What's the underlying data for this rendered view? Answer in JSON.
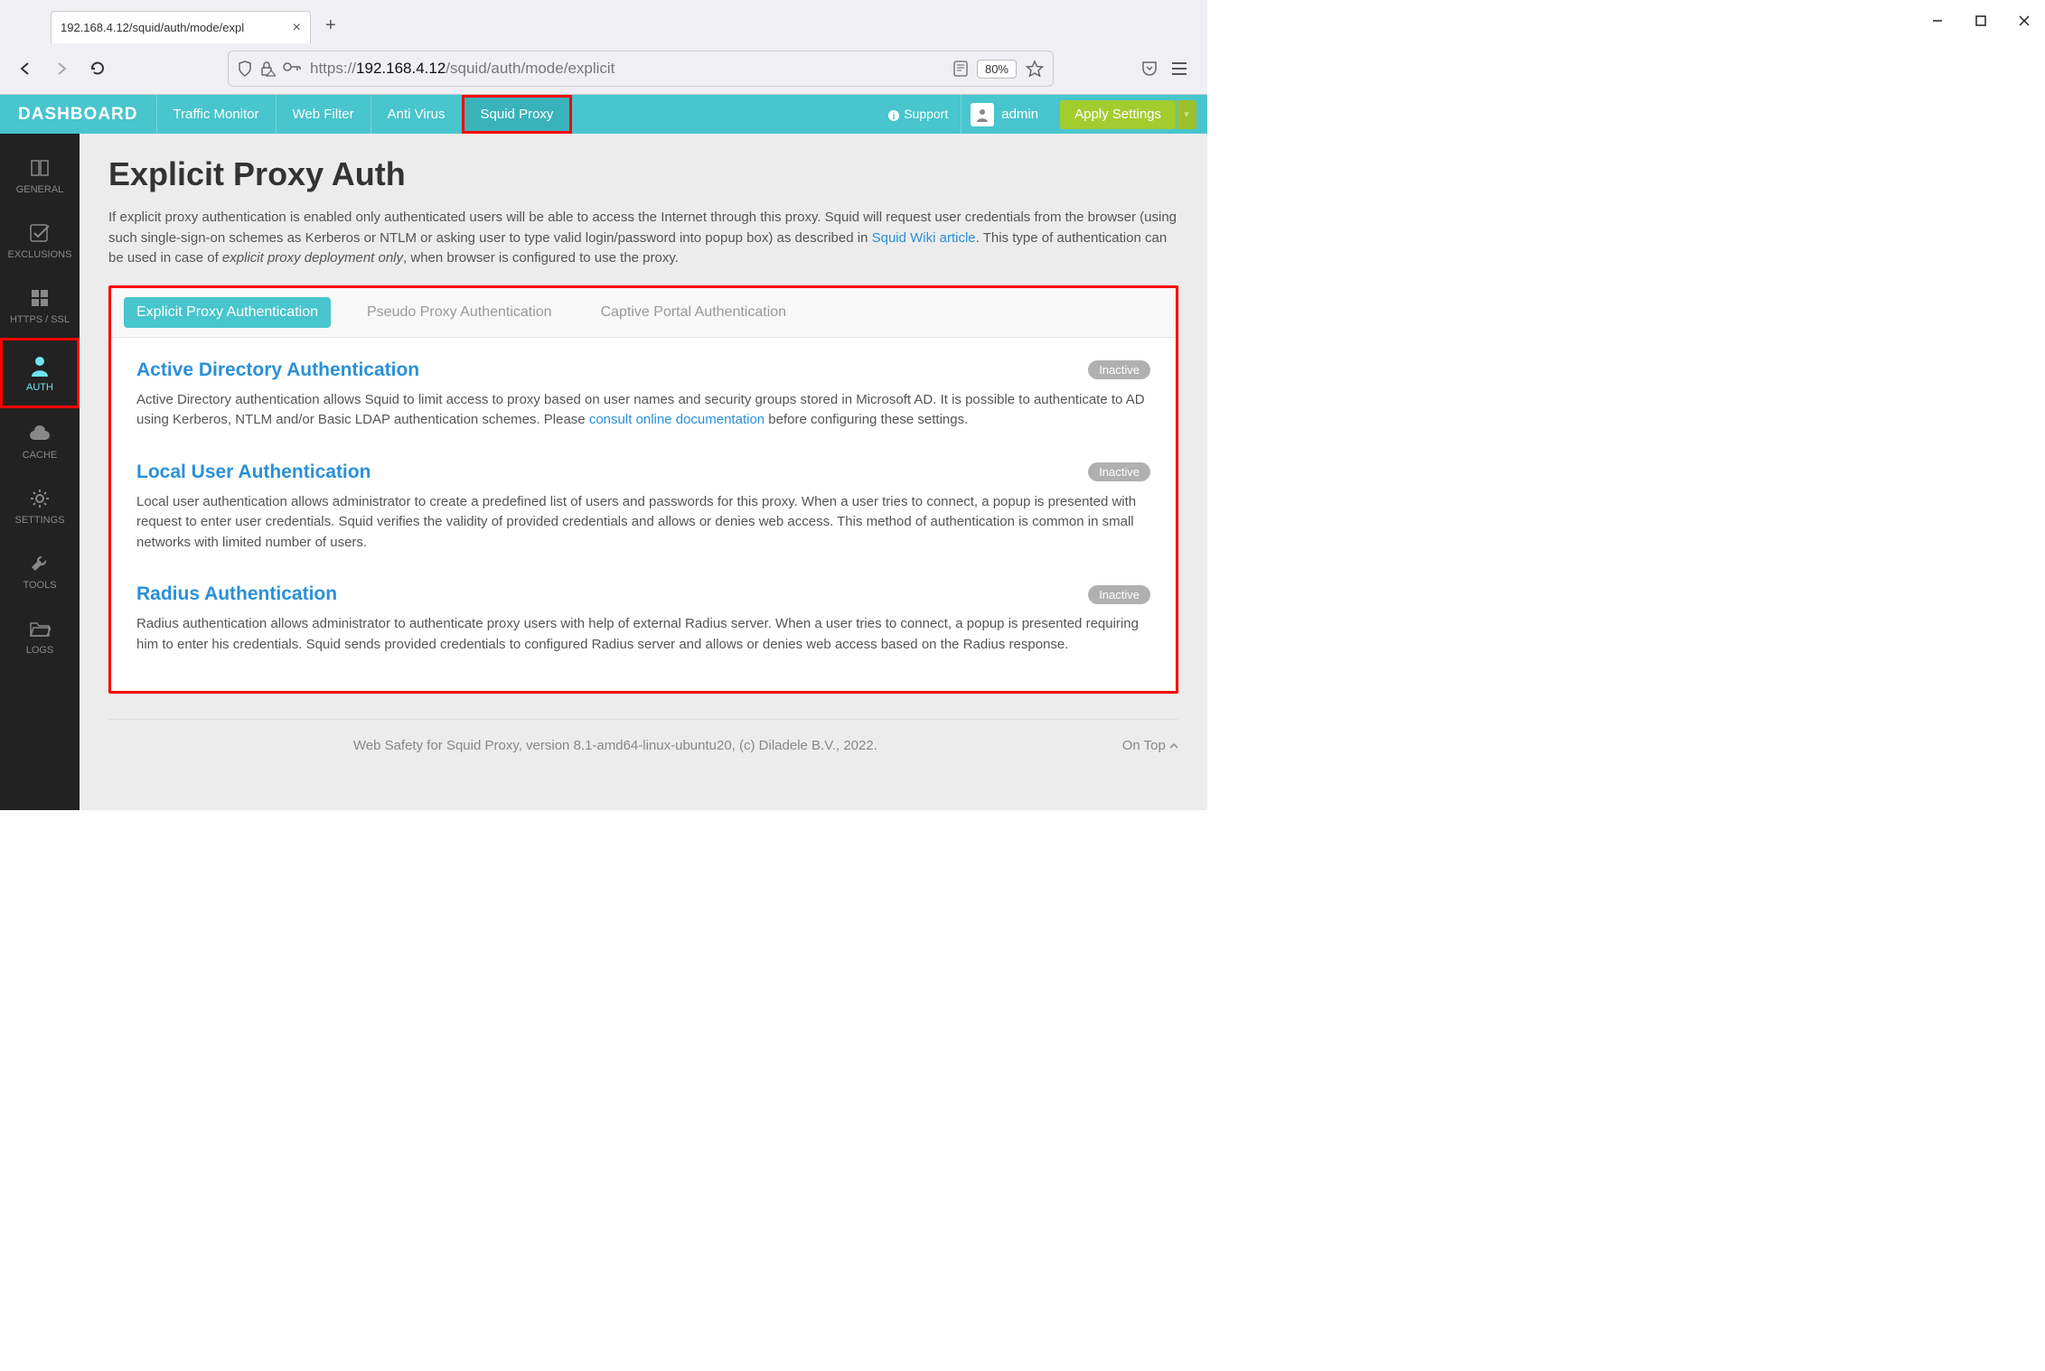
{
  "browser": {
    "tab_title": "192.168.4.12/squid/auth/mode/expl",
    "url_scheme": "https://",
    "url_host": "192.168.4.12",
    "url_path": "/squid/auth/mode/explicit",
    "zoom": "80%"
  },
  "header": {
    "brand": "DASHBOARD",
    "tabs": [
      "Traffic Monitor",
      "Web Filter",
      "Anti Virus",
      "Squid Proxy"
    ],
    "support": "Support",
    "user": "admin",
    "apply": "Apply Settings"
  },
  "sidebar": {
    "items": [
      {
        "label": "GENERAL",
        "icon": "book"
      },
      {
        "label": "EXCLUSIONS",
        "icon": "check"
      },
      {
        "label": "HTTPS / SSL",
        "icon": "grid"
      },
      {
        "label": "AUTH",
        "icon": "user"
      },
      {
        "label": "CACHE",
        "icon": "cloud"
      },
      {
        "label": "SETTINGS",
        "icon": "gear"
      },
      {
        "label": "TOOLS",
        "icon": "wrench"
      },
      {
        "label": "LOGS",
        "icon": "folder"
      }
    ]
  },
  "page": {
    "title": "Explicit Proxy Auth",
    "desc_before": "If explicit proxy authentication is enabled only authenticated users will be able to access the Internet through this proxy. Squid will request user credentials from the browser (using such single-sign-on schemes as Kerberos or NTLM or asking user to type valid login/password into popup box) as described in ",
    "desc_link": "Squid Wiki article",
    "desc_mid": ". This type of authentication can be used in case of ",
    "desc_ital": "explicit proxy deployment only",
    "desc_after": ", when browser is configured to use the proxy.",
    "tabs": [
      "Explicit Proxy Authentication",
      "Pseudo Proxy Authentication",
      "Captive Portal Authentication"
    ],
    "auth": [
      {
        "title": "Active Directory Authentication",
        "status": "Inactive",
        "desc_before": "Active Directory authentication allows Squid to limit access to proxy based on user names and security groups stored in Microsoft AD. It is possible to authenticate to AD using Kerberos, NTLM and/or Basic LDAP authentication schemes. Please ",
        "desc_link": "consult online documentation",
        "desc_after": " before configuring these settings."
      },
      {
        "title": "Local User Authentication",
        "status": "Inactive",
        "desc_before": "Local user authentication allows administrator to create a predefined list of users and passwords for this proxy. When a user tries to connect, a popup is presented with request to enter user credentials. Squid verifies the validity of provided credentials and allows or denies web access. This method of authentication is common in small networks with limited number of users.",
        "desc_link": "",
        "desc_after": ""
      },
      {
        "title": "Radius Authentication",
        "status": "Inactive",
        "desc_before": "Radius authentication allows administrator to authenticate proxy users with help of external Radius server. When a user tries to connect, a popup is presented requiring him to enter his credentials. Squid sends provided credentials to configured Radius server and allows or denies web access based on the Radius response.",
        "desc_link": "",
        "desc_after": ""
      }
    ],
    "footer": "Web Safety for Squid Proxy, version 8.1-amd64-linux-ubuntu20, (c) Diladele B.V., 2022.",
    "ontop": "On Top"
  }
}
